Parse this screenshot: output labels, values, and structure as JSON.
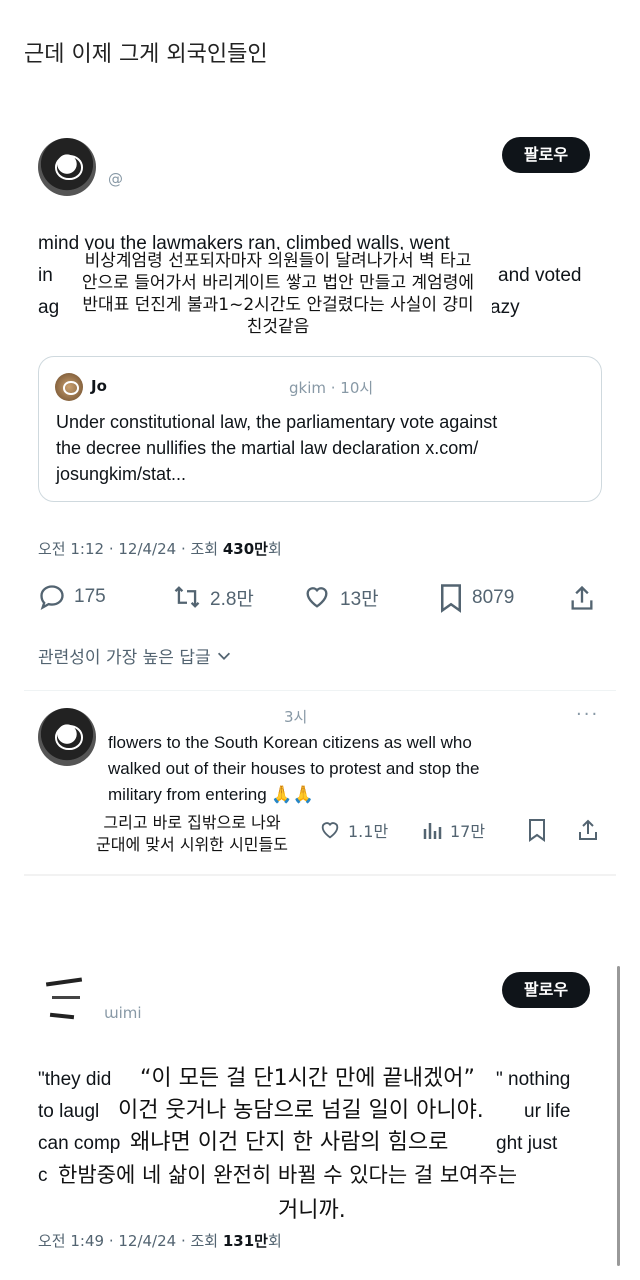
{
  "caption": "근데 이제 그게 외국인들인",
  "post1": {
    "handle": "@",
    "follow_label": "팔로우",
    "body_lines": [
      "mind you the lawmakers ran, climbed walls, went",
      "in",
      "ag",
      "and voted",
      "azy"
    ],
    "overlay_lines": [
      "비상계엄령 선포되자마자 의원들이 달려나가서 벽 타고",
      "안으로 들어가서 바리게이트 쌓고 법안 만들고 계엄령에",
      "반대표 던진게 불과1~2시간도 안걸렸다는 사실이 걍미",
      "친것같음"
    ],
    "quote": {
      "author": "Jo",
      "handle_time": "gkim · 10시",
      "text_lines": [
        "Under constitutional law, the parliamentary vote against",
        "the decree nullifies the martial law declaration x.com/",
        "josungkim/stat..."
      ]
    },
    "meta": {
      "time": "오전 1:12 · 12/4/24 · 조회 ",
      "views": "430만",
      "suffix": "회"
    },
    "actions": {
      "replies": "175",
      "retweets": "2.8만",
      "likes": "13만",
      "bookmarks": "8079"
    },
    "sort_label": "관련성이 가장 높은 답글"
  },
  "reply": {
    "time": "3시",
    "text_lines": [
      "flowers to the South Korean citizens as well who",
      "walked out of their houses to protest and stop the",
      "military from entering 🙏🙏"
    ],
    "overlay_lines": [
      "그리고 바로 집밖으로 나와",
      "군대에 맞서 시위한 시민들도"
    ],
    "likes": "1.1만",
    "views": "17만"
  },
  "post2": {
    "handle": "ɯimi",
    "follow_label": "팔로우",
    "body_fragments": [
      "\"they did",
      "\" nothing",
      "to laugl",
      "ur life",
      "can comp",
      "ght just",
      "c"
    ],
    "overlay_lines": [
      "“이 모든 걸 단1시간 만에 끝내겠어”",
      "이건 웃거나 농담으로 넘길 일이 아니야.",
      "왜냐면 이건 단지 한 사람의 힘으로",
      "한밤중에 네 삶이 완전히 바뀔 수 있다는 걸 보여주는",
      "거니까."
    ],
    "meta": {
      "time": "오전 1:49 · 12/4/24 · 조회 ",
      "views": "131만",
      "suffix": "회"
    }
  }
}
